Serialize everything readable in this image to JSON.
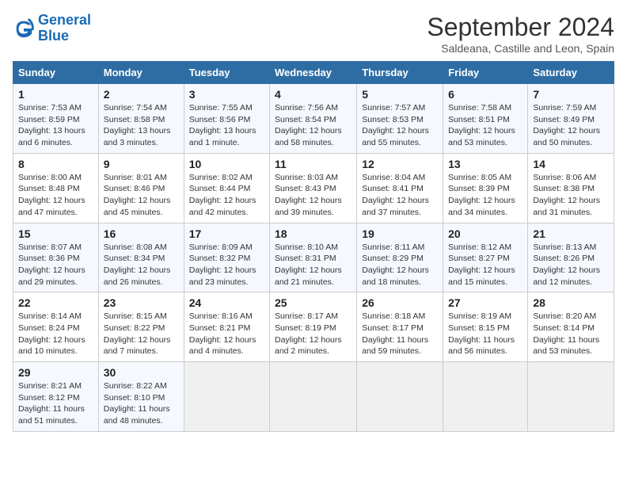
{
  "header": {
    "logo_line1": "General",
    "logo_line2": "Blue",
    "month": "September 2024",
    "location": "Saldeana, Castille and Leon, Spain"
  },
  "days_of_week": [
    "Sunday",
    "Monday",
    "Tuesday",
    "Wednesday",
    "Thursday",
    "Friday",
    "Saturday"
  ],
  "weeks": [
    [
      {
        "day": "1",
        "sunrise": "Sunrise: 7:53 AM",
        "sunset": "Sunset: 8:59 PM",
        "daylight": "Daylight: 13 hours and 6 minutes."
      },
      {
        "day": "2",
        "sunrise": "Sunrise: 7:54 AM",
        "sunset": "Sunset: 8:58 PM",
        "daylight": "Daylight: 13 hours and 3 minutes."
      },
      {
        "day": "3",
        "sunrise": "Sunrise: 7:55 AM",
        "sunset": "Sunset: 8:56 PM",
        "daylight": "Daylight: 13 hours and 1 minute."
      },
      {
        "day": "4",
        "sunrise": "Sunrise: 7:56 AM",
        "sunset": "Sunset: 8:54 PM",
        "daylight": "Daylight: 12 hours and 58 minutes."
      },
      {
        "day": "5",
        "sunrise": "Sunrise: 7:57 AM",
        "sunset": "Sunset: 8:53 PM",
        "daylight": "Daylight: 12 hours and 55 minutes."
      },
      {
        "day": "6",
        "sunrise": "Sunrise: 7:58 AM",
        "sunset": "Sunset: 8:51 PM",
        "daylight": "Daylight: 12 hours and 53 minutes."
      },
      {
        "day": "7",
        "sunrise": "Sunrise: 7:59 AM",
        "sunset": "Sunset: 8:49 PM",
        "daylight": "Daylight: 12 hours and 50 minutes."
      }
    ],
    [
      {
        "day": "8",
        "sunrise": "Sunrise: 8:00 AM",
        "sunset": "Sunset: 8:48 PM",
        "daylight": "Daylight: 12 hours and 47 minutes."
      },
      {
        "day": "9",
        "sunrise": "Sunrise: 8:01 AM",
        "sunset": "Sunset: 8:46 PM",
        "daylight": "Daylight: 12 hours and 45 minutes."
      },
      {
        "day": "10",
        "sunrise": "Sunrise: 8:02 AM",
        "sunset": "Sunset: 8:44 PM",
        "daylight": "Daylight: 12 hours and 42 minutes."
      },
      {
        "day": "11",
        "sunrise": "Sunrise: 8:03 AM",
        "sunset": "Sunset: 8:43 PM",
        "daylight": "Daylight: 12 hours and 39 minutes."
      },
      {
        "day": "12",
        "sunrise": "Sunrise: 8:04 AM",
        "sunset": "Sunset: 8:41 PM",
        "daylight": "Daylight: 12 hours and 37 minutes."
      },
      {
        "day": "13",
        "sunrise": "Sunrise: 8:05 AM",
        "sunset": "Sunset: 8:39 PM",
        "daylight": "Daylight: 12 hours and 34 minutes."
      },
      {
        "day": "14",
        "sunrise": "Sunrise: 8:06 AM",
        "sunset": "Sunset: 8:38 PM",
        "daylight": "Daylight: 12 hours and 31 minutes."
      }
    ],
    [
      {
        "day": "15",
        "sunrise": "Sunrise: 8:07 AM",
        "sunset": "Sunset: 8:36 PM",
        "daylight": "Daylight: 12 hours and 29 minutes."
      },
      {
        "day": "16",
        "sunrise": "Sunrise: 8:08 AM",
        "sunset": "Sunset: 8:34 PM",
        "daylight": "Daylight: 12 hours and 26 minutes."
      },
      {
        "day": "17",
        "sunrise": "Sunrise: 8:09 AM",
        "sunset": "Sunset: 8:32 PM",
        "daylight": "Daylight: 12 hours and 23 minutes."
      },
      {
        "day": "18",
        "sunrise": "Sunrise: 8:10 AM",
        "sunset": "Sunset: 8:31 PM",
        "daylight": "Daylight: 12 hours and 21 minutes."
      },
      {
        "day": "19",
        "sunrise": "Sunrise: 8:11 AM",
        "sunset": "Sunset: 8:29 PM",
        "daylight": "Daylight: 12 hours and 18 minutes."
      },
      {
        "day": "20",
        "sunrise": "Sunrise: 8:12 AM",
        "sunset": "Sunset: 8:27 PM",
        "daylight": "Daylight: 12 hours and 15 minutes."
      },
      {
        "day": "21",
        "sunrise": "Sunrise: 8:13 AM",
        "sunset": "Sunset: 8:26 PM",
        "daylight": "Daylight: 12 hours and 12 minutes."
      }
    ],
    [
      {
        "day": "22",
        "sunrise": "Sunrise: 8:14 AM",
        "sunset": "Sunset: 8:24 PM",
        "daylight": "Daylight: 12 hours and 10 minutes."
      },
      {
        "day": "23",
        "sunrise": "Sunrise: 8:15 AM",
        "sunset": "Sunset: 8:22 PM",
        "daylight": "Daylight: 12 hours and 7 minutes."
      },
      {
        "day": "24",
        "sunrise": "Sunrise: 8:16 AM",
        "sunset": "Sunset: 8:21 PM",
        "daylight": "Daylight: 12 hours and 4 minutes."
      },
      {
        "day": "25",
        "sunrise": "Sunrise: 8:17 AM",
        "sunset": "Sunset: 8:19 PM",
        "daylight": "Daylight: 12 hours and 2 minutes."
      },
      {
        "day": "26",
        "sunrise": "Sunrise: 8:18 AM",
        "sunset": "Sunset: 8:17 PM",
        "daylight": "Daylight: 11 hours and 59 minutes."
      },
      {
        "day": "27",
        "sunrise": "Sunrise: 8:19 AM",
        "sunset": "Sunset: 8:15 PM",
        "daylight": "Daylight: 11 hours and 56 minutes."
      },
      {
        "day": "28",
        "sunrise": "Sunrise: 8:20 AM",
        "sunset": "Sunset: 8:14 PM",
        "daylight": "Daylight: 11 hours and 53 minutes."
      }
    ],
    [
      {
        "day": "29",
        "sunrise": "Sunrise: 8:21 AM",
        "sunset": "Sunset: 8:12 PM",
        "daylight": "Daylight: 11 hours and 51 minutes."
      },
      {
        "day": "30",
        "sunrise": "Sunrise: 8:22 AM",
        "sunset": "Sunset: 8:10 PM",
        "daylight": "Daylight: 11 hours and 48 minutes."
      },
      null,
      null,
      null,
      null,
      null
    ]
  ]
}
